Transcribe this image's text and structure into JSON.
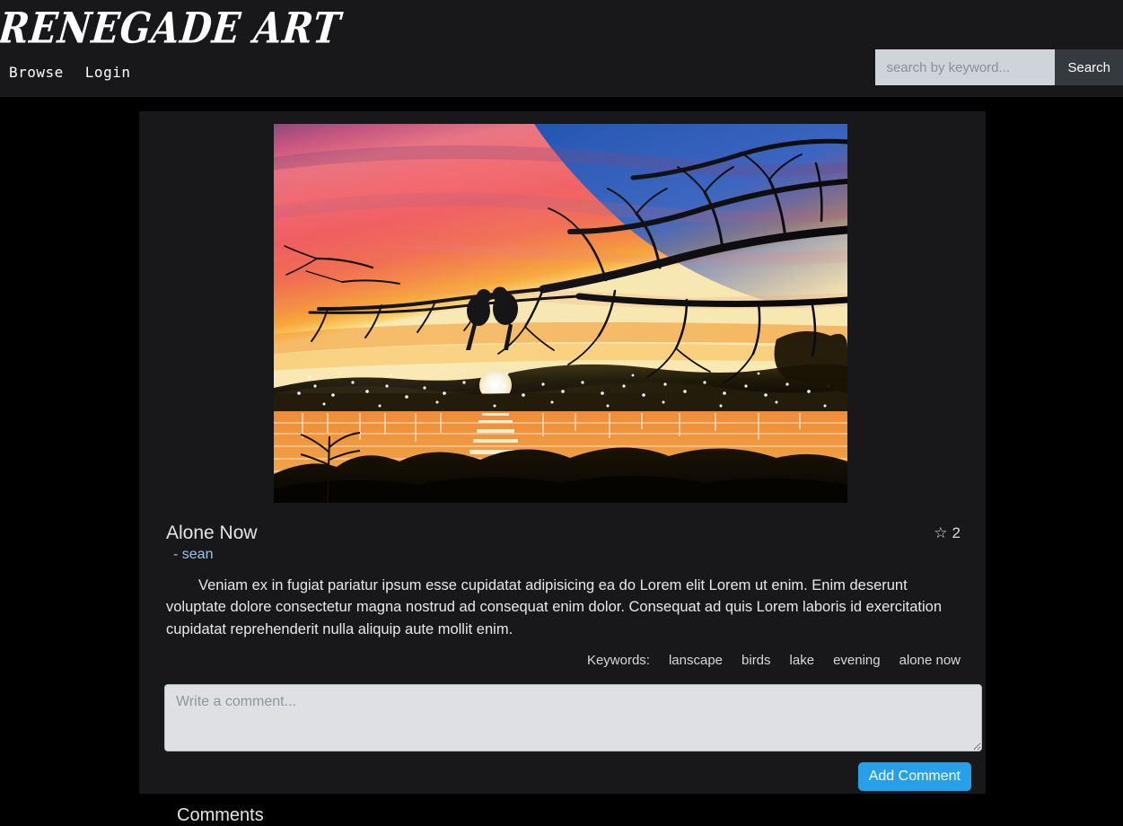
{
  "header": {
    "brand": "Renegade Art",
    "nav": [
      {
        "label": "Browse"
      },
      {
        "label": "Login"
      }
    ],
    "search": {
      "value": "",
      "placeholder": "search by keyword...",
      "button_label": "Search"
    }
  },
  "artwork": {
    "title": "Alone Now",
    "artist_dash": "-",
    "artist": "sean",
    "favorites_icon": "star-outline-icon",
    "favorites_count": "2",
    "description": "Veniam ex in fugiat pariatur ipsum esse cupidatat adipisicing ea do Lorem elit Lorem ut enim. Enim deserunt voluptate dolore consectetur magna nostrud ad consequat enim dolor. Consequat ad quis Lorem laboris id exercitation cupidatat reprehenderit nulla aliquip aute mollit enim.",
    "keywords_label": "Keywords:",
    "keywords": [
      "lanscape",
      "birds",
      "lake",
      "evening",
      "alone now"
    ],
    "image_alt": "Sunset painting of two birds silhouetted on a tree branch above a lake with hillside lights"
  },
  "comment_form": {
    "placeholder": "Write a comment...",
    "value": "",
    "submit_label": "Add Comment"
  },
  "comments_section": {
    "heading": "Comments"
  },
  "colors": {
    "page_background": "#000000",
    "header_background": "#18181b",
    "card_background": "#18181a",
    "accent_blue": "#26a0e8",
    "link_blue": "#9ec5e8",
    "search_field": "#ced4da",
    "search_button": "#343a40"
  }
}
